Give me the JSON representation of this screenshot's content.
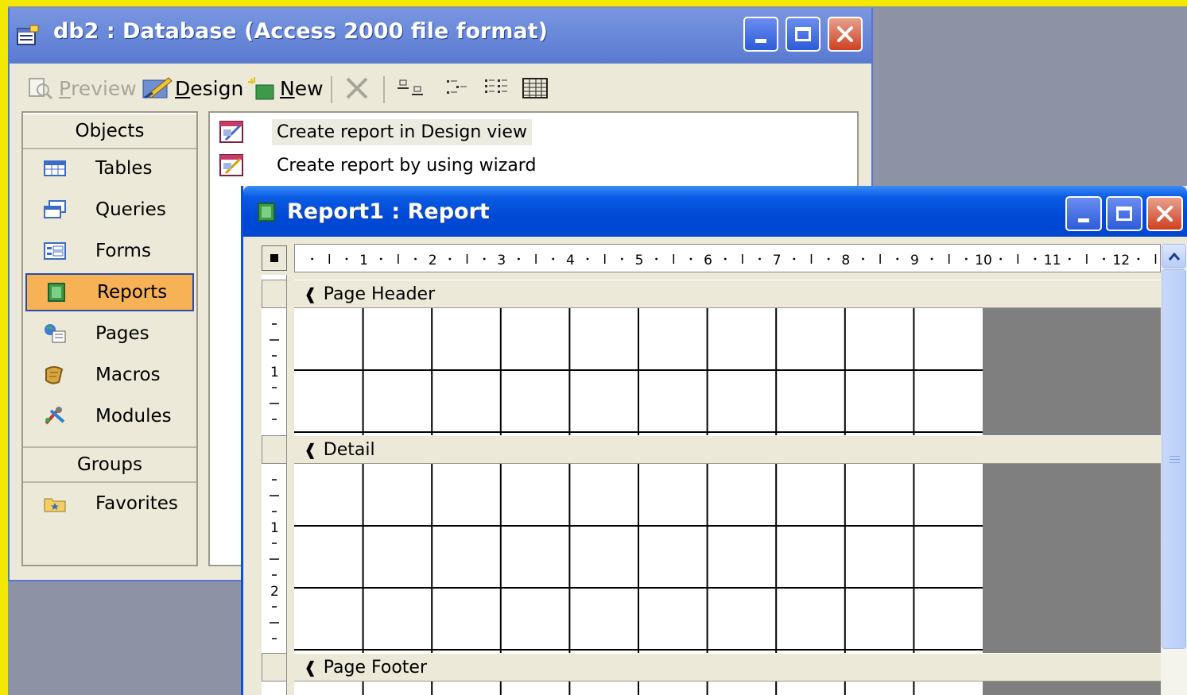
{
  "database_window": {
    "title": "db2 : Database (Access 2000 file format)",
    "toolbar": {
      "preview": {
        "label": "Preview",
        "mnemonic": "P",
        "rest": "review",
        "enabled": false
      },
      "design": {
        "label": "Design",
        "mnemonic": "D",
        "rest": "esign"
      },
      "new": {
        "label": "New",
        "mnemonic": "N",
        "rest": "ew"
      },
      "icons": [
        "delete-icon",
        "large-icons-view-icon",
        "small-icons-view-icon",
        "list-view-icon",
        "details-view-icon"
      ]
    },
    "objects_header": "Objects",
    "objects": [
      {
        "label": "Tables",
        "icon": "table-icon"
      },
      {
        "label": "Queries",
        "icon": "query-icon"
      },
      {
        "label": "Forms",
        "icon": "form-icon"
      },
      {
        "label": "Reports",
        "icon": "report-icon",
        "selected": true
      },
      {
        "label": "Pages",
        "icon": "page-icon"
      },
      {
        "label": "Macros",
        "icon": "macro-icon"
      },
      {
        "label": "Modules",
        "icon": "module-icon"
      }
    ],
    "groups_header": "Groups",
    "groups": [
      {
        "label": "Favorites",
        "icon": "favorites-folder-icon"
      }
    ],
    "list_items": [
      {
        "label": "Create report in Design view",
        "icon": "report-design-icon",
        "highlighted": true
      },
      {
        "label": "Create report by using wizard",
        "icon": "report-wizard-icon"
      }
    ]
  },
  "report_window": {
    "title": "Report1 : Report",
    "ruler_numbers": [
      "1",
      "2",
      "3",
      "4",
      "5",
      "6",
      "7",
      "8",
      "9",
      "10",
      "11",
      "12"
    ],
    "sections": [
      {
        "label": "Page Header",
        "vruler_numbers": [
          "1"
        ]
      },
      {
        "label": "Detail",
        "vruler_numbers": [
          "1",
          "2"
        ]
      },
      {
        "label": "Page Footer",
        "vruler_numbers": []
      }
    ]
  },
  "colors": {
    "frame": "#f3e800",
    "desktop": "#8d93a5",
    "selected_item": "#f6b254",
    "xp_title_blue": "#0049d6",
    "report_canvas_outside": "#7f7f7f"
  }
}
